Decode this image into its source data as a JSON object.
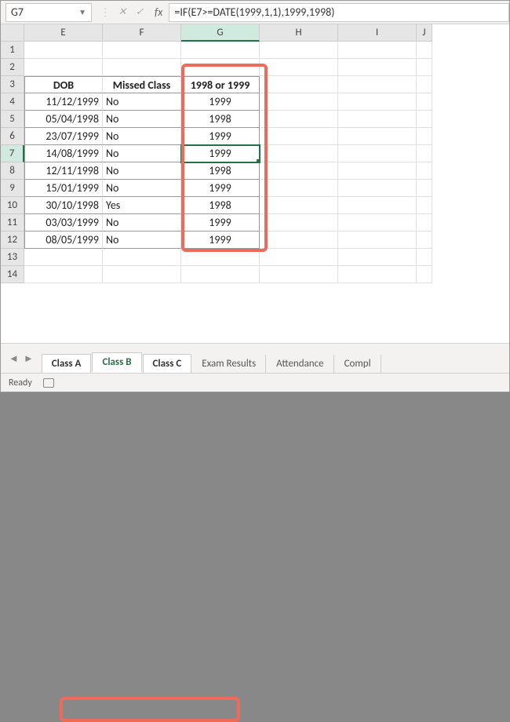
{
  "nameBox": "G7",
  "formula": "=IF(E7>=DATE(1999,1,1),1999,1998)",
  "fxLabel": "fx",
  "columns": [
    "E",
    "F",
    "G",
    "H",
    "I",
    "J"
  ],
  "activeColIndex": 2,
  "activeRowIndex": 6,
  "rowNumbers": [
    "1",
    "2",
    "3",
    "4",
    "5",
    "6",
    "7",
    "8",
    "9",
    "10",
    "11",
    "12",
    "13",
    "14"
  ],
  "headerRow": {
    "E": "DOB",
    "F": "Missed Class",
    "G": "1998 or 1999"
  },
  "chart_data": {
    "type": "table",
    "title": "",
    "columns": [
      "DOB",
      "Missed Class",
      "1998 or 1999"
    ],
    "rows": [
      {
        "DOB": "11/12/1999",
        "Missed Class": "No",
        "1998 or 1999": "1999"
      },
      {
        "DOB": "05/04/1998",
        "Missed Class": "No",
        "1998 or 1999": "1998"
      },
      {
        "DOB": "23/07/1999",
        "Missed Class": "No",
        "1998 or 1999": "1999"
      },
      {
        "DOB": "14/08/1999",
        "Missed Class": "No",
        "1998 or 1999": "1999"
      },
      {
        "DOB": "12/11/1998",
        "Missed Class": "No",
        "1998 or 1999": "1998"
      },
      {
        "DOB": "15/01/1999",
        "Missed Class": "No",
        "1998 or 1999": "1999"
      },
      {
        "DOB": "30/10/1998",
        "Missed Class": "Yes",
        "1998 or 1999": "1998"
      },
      {
        "DOB": "03/03/1999",
        "Missed Class": "No",
        "1998 or 1999": "1999"
      },
      {
        "DOB": "08/05/1999",
        "Missed Class": "No",
        "1998 or 1999": "1999"
      }
    ]
  },
  "tabs": {
    "grouped": [
      "Class A",
      "Class B",
      "Class C"
    ],
    "activeGrouped": 1,
    "others": [
      "Exam Results",
      "Attendance",
      "Compl"
    ]
  },
  "status": "Ready"
}
